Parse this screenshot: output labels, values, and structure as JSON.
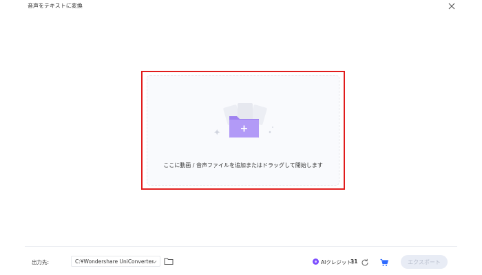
{
  "window": {
    "title": "音声をテキストに変換"
  },
  "dropzone": {
    "text": "ここに動画 / 音声ファイルを追加またはドラッグして開始します"
  },
  "footer": {
    "output_label": "出力先:",
    "output_path": "C:¥Wondershare UniConverter",
    "credits_label": "AIクレジット：",
    "credits_count": "31",
    "export_label": "エクスポート"
  },
  "colors": {
    "highlight_border": "#e11b1b",
    "folder_purple": "#a98bf2",
    "credit_purple": "#7c4dff",
    "cart_blue": "#2f6bff",
    "export_bg": "#e8ecf5"
  },
  "icons": {
    "close": "close-icon",
    "folder_add": "folder-plus-icon",
    "dropdown": "chevron-down-icon",
    "folder": "folder-icon",
    "credit": "ai-credit-icon",
    "refresh": "refresh-icon",
    "cart": "cart-icon"
  }
}
